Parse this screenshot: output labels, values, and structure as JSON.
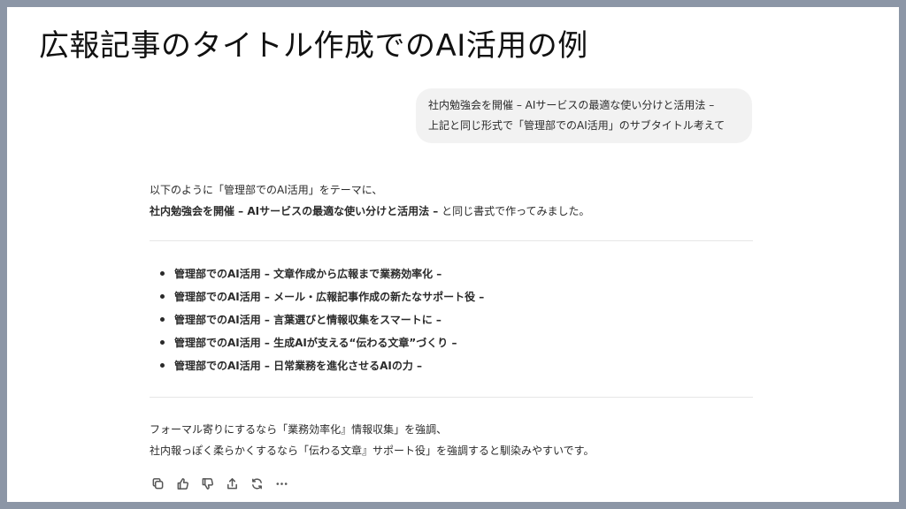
{
  "slide": {
    "title": "広報記事のタイトル作成でのAI活用の例"
  },
  "user_message": {
    "line1": "社内勉強会を開催 – AIサービスの最適な使い分けと活用法 –",
    "line2": "上記と同じ形式で「管理部でのAI活用」のサブタイトル考えて"
  },
  "assistant": {
    "intro_line1": "以下のように「管理部でのAI活用」をテーマに、",
    "intro_line2_bold": "社内勉強会を開催 – AIサービスの最適な使い分けと活用法 –",
    "intro_line2_rest": " と同じ書式で作ってみました。",
    "items": [
      {
        "bold": "管理部でのAI活用 – 文章作成から広報まで業務効率化 –"
      },
      {
        "bold": "管理部でのAI活用 – メール・広報記事作成の新たなサポート役 –"
      },
      {
        "bold": "管理部でのAI活用 – 言葉選びと情報収集をスマートに –"
      },
      {
        "bold": "管理部でのAI活用 – 生成AIが支える“伝わる文章”づくり –"
      },
      {
        "bold": "管理部でのAI活用 – 日常業務を進化させるAIの力 –"
      }
    ],
    "closing_line1": "フォーマル寄りにするなら「業務効率化』情報収集」を強調、",
    "closing_line2": "社内報っぽく柔らかくするなら「伝わる文章』サポート役」を強調すると馴染みやすいです。"
  },
  "actions": {
    "icons": [
      "copy-icon",
      "thumbs-up-icon",
      "thumbs-down-icon",
      "share-icon",
      "regenerate-icon",
      "more-icon"
    ]
  }
}
